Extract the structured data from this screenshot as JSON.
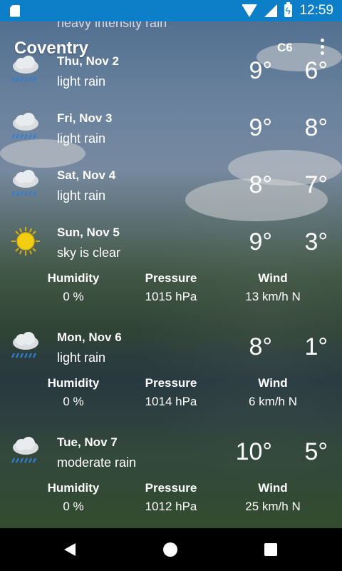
{
  "status": {
    "time": "12:59"
  },
  "appbar": {
    "title": "Coventry",
    "badge": "C6"
  },
  "peek": {
    "desc": "heavy intensity rain"
  },
  "days": [
    {
      "date": "Thu, Nov 2",
      "desc": "light rain",
      "hi": "9°",
      "lo": "6°",
      "icon": "rain-cloud-icon"
    },
    {
      "date": "Fri, Nov 3",
      "desc": "light rain",
      "hi": "9°",
      "lo": "8°",
      "icon": "rain-cloud-icon"
    },
    {
      "date": "Sat, Nov 4",
      "desc": "light rain",
      "hi": "8°",
      "lo": "7°",
      "icon": "rain-cloud-icon"
    },
    {
      "date": "Sun, Nov 5",
      "desc": "sky is clear",
      "hi": "9°",
      "lo": "3°",
      "icon": "sun-icon",
      "details": {
        "humidity_label": "Humidity",
        "humidity": "0 %",
        "pressure_label": "Pressure",
        "pressure": "1015 hPa",
        "wind_label": "Wind",
        "wind": "13 km/h N"
      }
    },
    {
      "date": "Mon, Nov 6",
      "desc": "light rain",
      "hi": "8°",
      "lo": "1°",
      "icon": "rain-cloud-icon",
      "details": {
        "humidity_label": "Humidity",
        "humidity": "0 %",
        "pressure_label": "Pressure",
        "pressure": "1014 hPa",
        "wind_label": "Wind",
        "wind": "6 km/h N"
      }
    },
    {
      "date": "Tue, Nov 7",
      "desc": "moderate rain",
      "hi": "10°",
      "lo": "5°",
      "icon": "rain-cloud-icon",
      "details": {
        "humidity_label": "Humidity",
        "humidity": "0 %",
        "pressure_label": "Pressure",
        "pressure": "1012 hPa",
        "wind_label": "Wind",
        "wind": "25 km/h N"
      }
    }
  ]
}
